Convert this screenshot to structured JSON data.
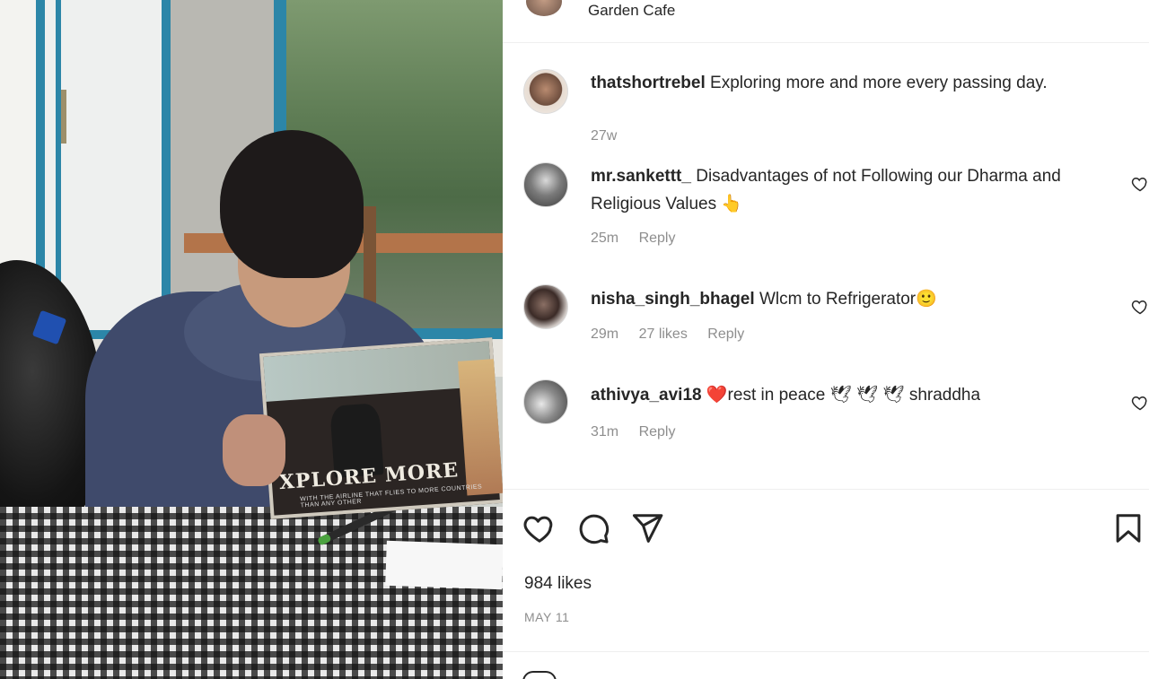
{
  "post": {
    "location": "Garden Cafe",
    "photo_label": "Person reading a magazine at a checkered table",
    "magazine_title": "XPLORE MORE",
    "magazine_subtitle": "WITH THE AIRLINE THAT FLIES TO MORE COUNTRIES THAN ANY OTHER"
  },
  "caption": {
    "username": "thatshortrebel",
    "text": "Exploring more and more every passing day.",
    "time": "27w"
  },
  "comments": [
    {
      "username": "mr.sankettt_",
      "text": "Disadvantages of not Following our Dharma and Religious Values",
      "emoji": "👆",
      "time": "25m",
      "likes": "",
      "reply_label": "Reply"
    },
    {
      "username": "nisha_singh_bhagel",
      "text": "Wlcm to Refrigerator",
      "emoji": "🙂",
      "time": "29m",
      "likes": "27 likes",
      "reply_label": "Reply"
    },
    {
      "username": "athivya_avi18",
      "prefix_emoji": "❤️",
      "text": "rest in peace",
      "emoji": "🕊 🕊 🕊",
      "suffix": "shraddha",
      "time": "31m",
      "likes": "",
      "reply_label": "Reply"
    }
  ],
  "actions": {
    "like_icon": "heart-icon",
    "comment_icon": "comment-icon",
    "share_icon": "paper-plane-icon",
    "save_icon": "bookmark-icon",
    "likes_count": "984 likes",
    "date": "MAY 11"
  },
  "colors": {
    "text": "#262626",
    "muted": "#8e8e8e",
    "divider": "#efefef",
    "heart_red": "#ed4956"
  }
}
